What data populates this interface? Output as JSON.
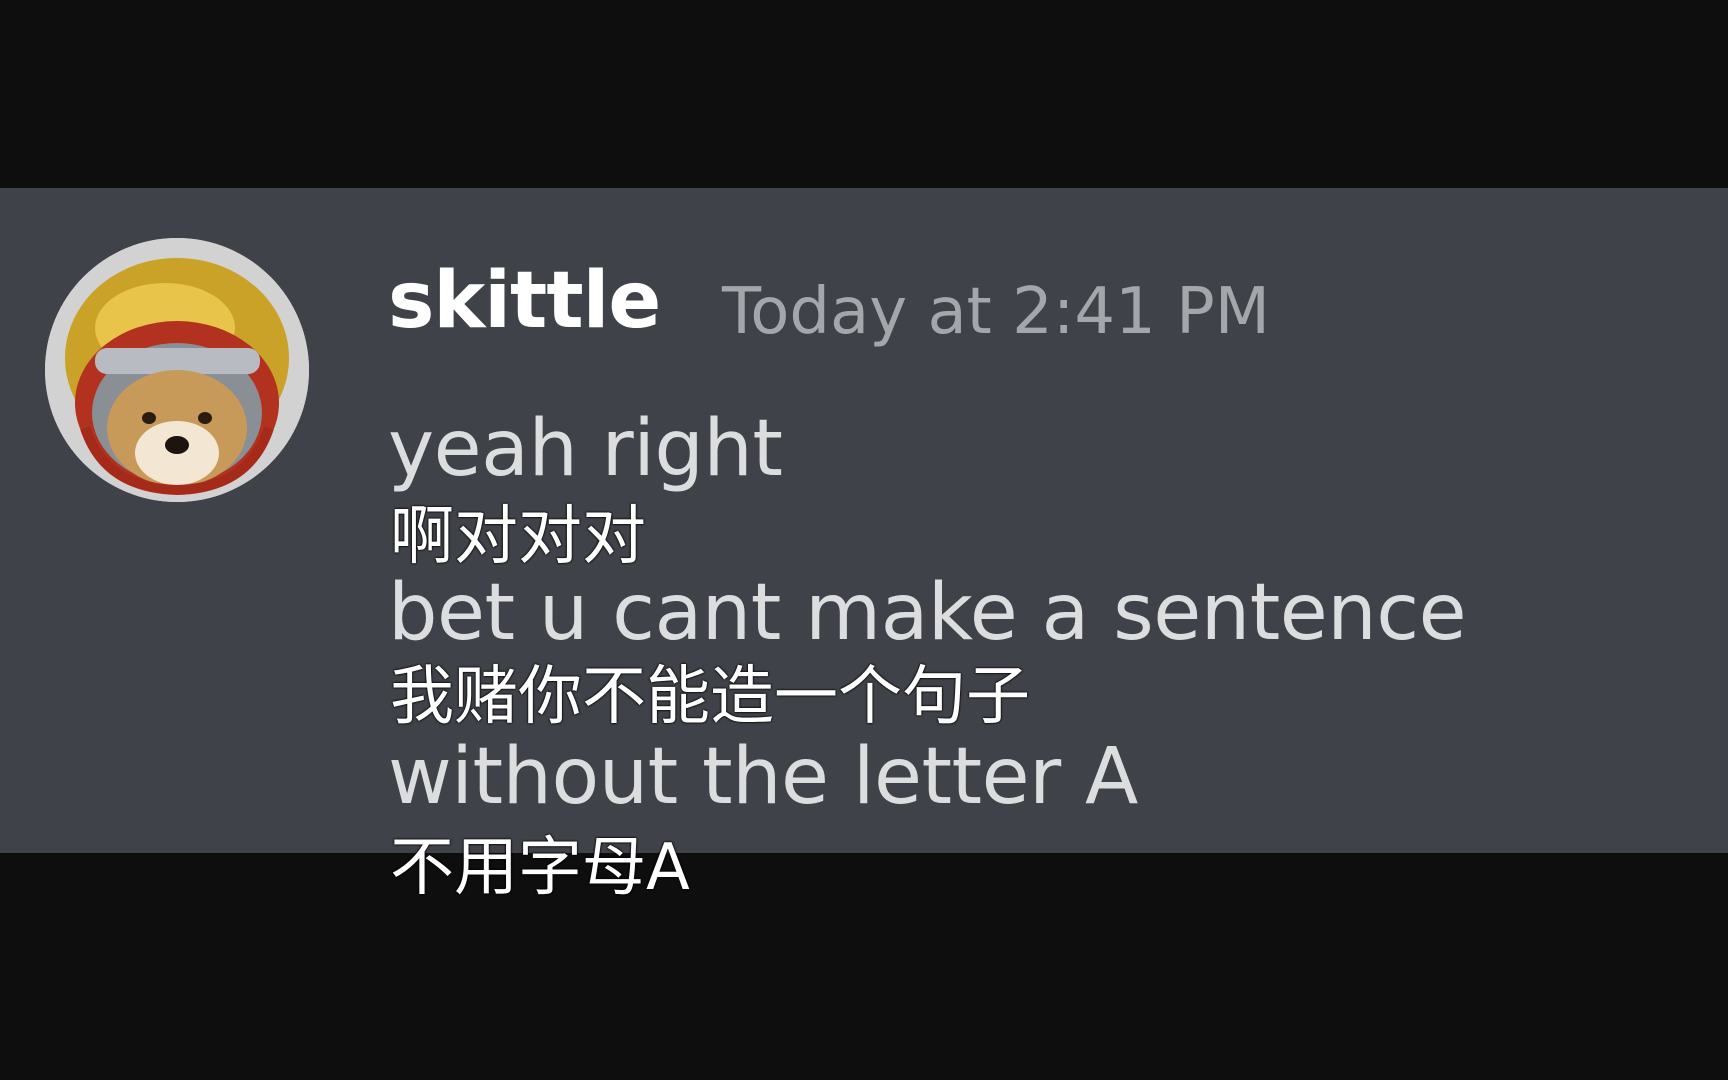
{
  "message": {
    "author": "skittle",
    "timestamp": "Today at 2:41 PM",
    "avatar_icon": "shiba-dog-in-helmet-avatar",
    "lines": [
      "yeah right",
      "bet u cant make a sentence",
      "without the letter A"
    ]
  },
  "subtitles": [
    "啊对对对",
    "我赌你不能造一个句子",
    "不用字母A"
  ],
  "colors": {
    "page_background": "#0e0e0e",
    "message_background": "#3f4248",
    "author": "#ffffff",
    "timestamp": "#a3a6aa",
    "message_text": "#dcddde",
    "subtitle_text": "#ffffff"
  }
}
